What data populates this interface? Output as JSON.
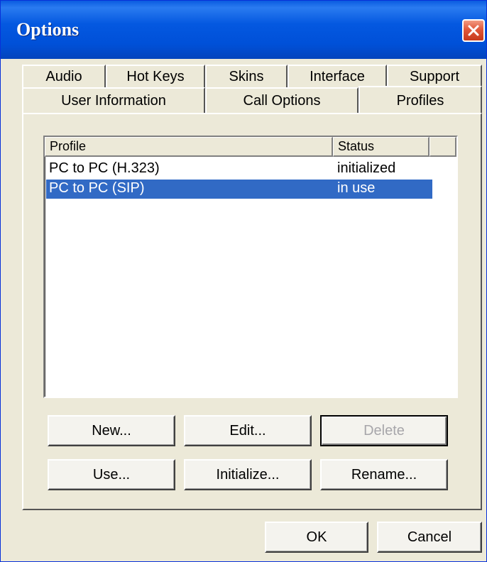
{
  "window": {
    "title": "Options"
  },
  "tabs": {
    "back_row": [
      {
        "label": "Audio"
      },
      {
        "label": "Hot Keys"
      },
      {
        "label": "Skins"
      },
      {
        "label": "Interface"
      },
      {
        "label": "Support"
      }
    ],
    "front_row": [
      {
        "label": "User Information"
      },
      {
        "label": "Call Options"
      },
      {
        "label": "Profiles"
      }
    ],
    "active": "Profiles"
  },
  "profiles_list": {
    "columns": [
      "Profile",
      "Status"
    ],
    "rows": [
      {
        "profile": "PC to PC (H.323)",
        "status": "initialized",
        "selected": false
      },
      {
        "profile": "PC to PC (SIP)",
        "status": "in use",
        "selected": true
      }
    ]
  },
  "buttons": {
    "new": "New...",
    "edit": "Edit...",
    "delete": "Delete",
    "use": "Use...",
    "initialize": "Initialize...",
    "rename": "Rename..."
  },
  "dialog_buttons": {
    "ok": "OK",
    "cancel": "Cancel"
  },
  "colors": {
    "titlebar": "#0458e0",
    "window_bg": "#ece9d8",
    "selection": "#316ac5",
    "close": "#e0573a"
  },
  "icons": {
    "close": "close-icon"
  }
}
